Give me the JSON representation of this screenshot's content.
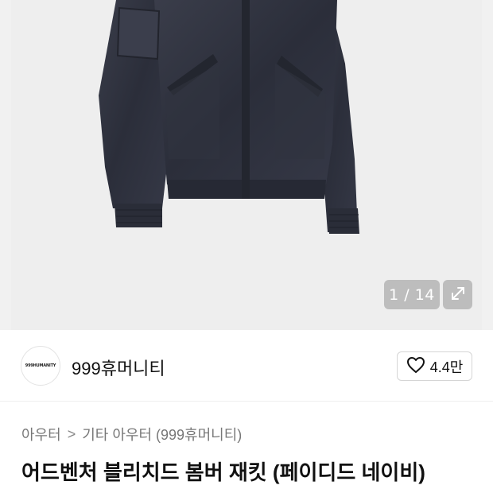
{
  "gallery": {
    "image_alt": "navy bomber jacket",
    "counter": "1 / 14",
    "icons": {
      "expand": "expand-arrows-icon"
    }
  },
  "store": {
    "logo_text": "999HUMANITY",
    "name": "999휴머니티",
    "like_count": "4.4만",
    "icons": {
      "like": "heart-outline-icon"
    }
  },
  "breadcrumb": {
    "items": [
      "아우터",
      "기타 아우터 (999휴머니티)"
    ],
    "separator": ">"
  },
  "product": {
    "title": "어드벤처 블리치드 봄버 재킷 (페이디드 네이비)"
  }
}
